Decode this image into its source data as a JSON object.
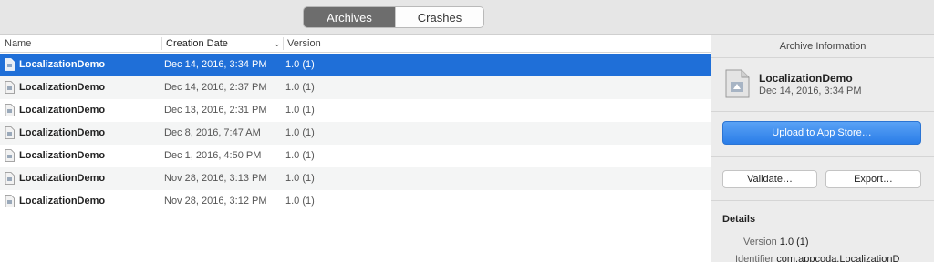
{
  "toolbar": {
    "tabs": [
      {
        "label": "Archives",
        "active": true
      },
      {
        "label": "Crashes",
        "active": false
      }
    ]
  },
  "list": {
    "columns": [
      "Name",
      "Creation Date",
      "Version"
    ],
    "rows": [
      {
        "name": "LocalizationDemo",
        "date": "Dec 14, 2016, 3:34 PM",
        "version": "1.0 (1)",
        "selected": true
      },
      {
        "name": "LocalizationDemo",
        "date": "Dec 14, 2016, 2:37 PM",
        "version": "1.0 (1)"
      },
      {
        "name": "LocalizationDemo",
        "date": "Dec 13, 2016, 2:31 PM",
        "version": "1.0 (1)"
      },
      {
        "name": "LocalizationDemo",
        "date": "Dec 8, 2016, 7:47 AM",
        "version": "1.0 (1)"
      },
      {
        "name": "LocalizationDemo",
        "date": "Dec 1, 2016, 4:50 PM",
        "version": "1.0 (1)"
      },
      {
        "name": "LocalizationDemo",
        "date": "Nov 28, 2016, 3:13 PM",
        "version": "1.0 (1)"
      },
      {
        "name": "LocalizationDemo",
        "date": "Nov 28, 2016, 3:12 PM",
        "version": "1.0 (1)"
      }
    ]
  },
  "inspector": {
    "title": "Archive Information",
    "archive_name": "LocalizationDemo",
    "archive_date": "Dec 14, 2016, 3:34 PM",
    "upload_label": "Upload to App Store…",
    "validate_label": "Validate…",
    "export_label": "Export…",
    "details_title": "Details",
    "version_key": "Version",
    "version_value": "1.0 (1)",
    "identifier_key": "Identifier",
    "identifier_value": "com.appcoda.LocalizationD"
  },
  "colors": {
    "selection": "#1f6fd8",
    "accent_button": "#2a7de8"
  }
}
